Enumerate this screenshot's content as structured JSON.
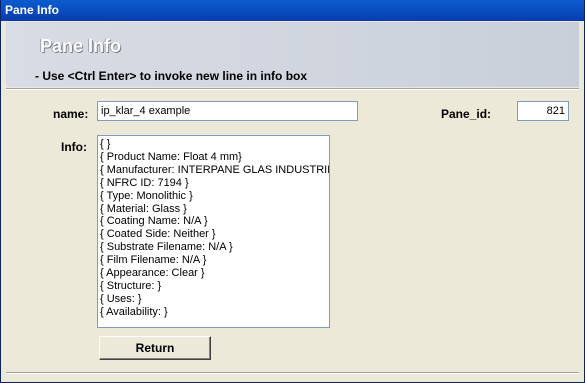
{
  "window": {
    "title": "Pane Info"
  },
  "header": {
    "title": "Pane Info",
    "subtitle": "- Use <Ctrl Enter> to invoke new line in info box"
  },
  "form": {
    "name_label": "name:",
    "name_value": "ip_klar_4 example",
    "pane_id_label": "Pane_id:",
    "pane_id_value": "821",
    "info_label": "Info:",
    "info_lines": [
      "{ }",
      "{ Product Name: Float 4 mm}",
      "{ Manufacturer: INTERPANE GLAS INDUSTRIE AG }",
      "{ NFRC ID: 7194 }",
      "{ Type: Monolithic }",
      "{ Material: Glass }",
      "{ Coating Name: N/A }",
      "{ Coated Side: Neither }",
      "{ Substrate Filename: N/A }",
      "{ Film Filename: N/A }",
      "{ Appearance: Clear }",
      "{ Structure:  }",
      "{ Uses:  }",
      "{ Availability:  }"
    ]
  },
  "buttons": {
    "return_label": "Return"
  },
  "colors": {
    "titlebar": "#0a4fc0",
    "background": "#ece9d8"
  }
}
